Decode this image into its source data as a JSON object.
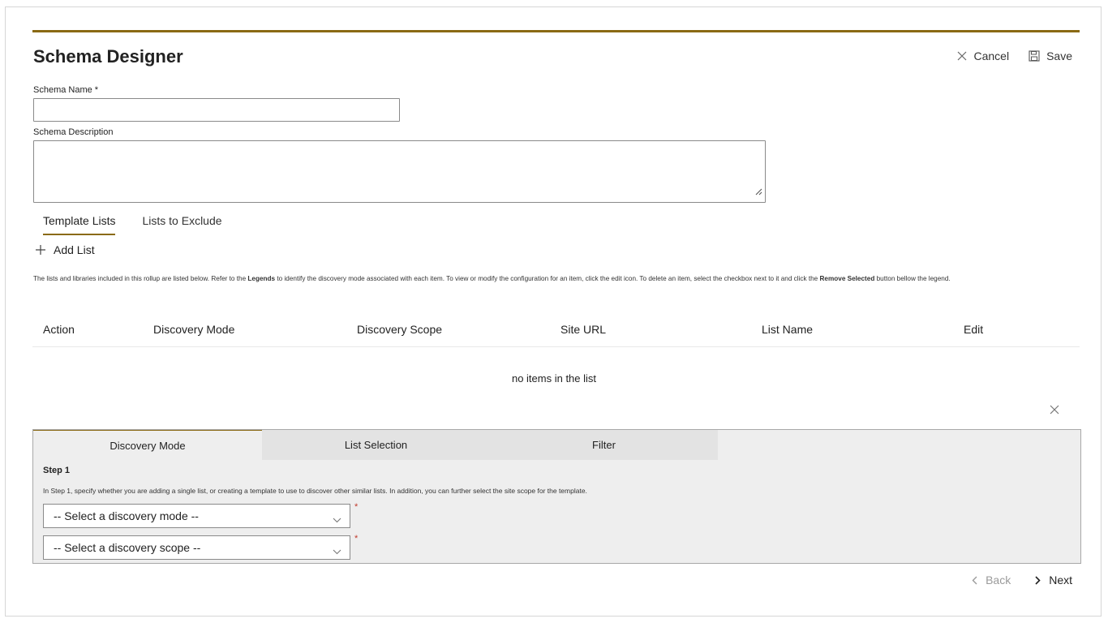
{
  "header": {
    "title": "Schema Designer",
    "cancel_label": "Cancel",
    "save_label": "Save",
    "accent_color": "#8a6a14"
  },
  "form": {
    "schema_name_label": "Schema Name *",
    "schema_name_value": "",
    "schema_description_label": "Schema Description",
    "schema_description_value": ""
  },
  "tabs": [
    {
      "label": "Template Lists",
      "active": true
    },
    {
      "label": "Lists to Exclude",
      "active": false
    }
  ],
  "add_list_label": "Add List",
  "help_text": {
    "part1": "The lists and libraries included in this rollup are listed below. Refer to the ",
    "legends": "Legends",
    "part2": " to identify the discovery mode associated with each item. To view or modify the configuration for an item, click the edit icon. To delete an item, select the checkbox next to it and click the ",
    "remove_selected": "Remove Selected",
    "part3": " button bellow the legend."
  },
  "table": {
    "columns": [
      "Action",
      "Discovery Mode",
      "Discovery Scope",
      "Site URL",
      "List Name",
      "Edit"
    ],
    "rows": [],
    "empty_text": "no items in the list"
  },
  "wizard": {
    "tabs": [
      {
        "label": "Discovery Mode",
        "active": true
      },
      {
        "label": "List Selection",
        "active": false
      },
      {
        "label": "Filter",
        "active": false
      }
    ],
    "step_title": "Step 1",
    "step_text": "In Step 1, specify whether you are adding a single list, or creating a template to use to discover other similar lists. In addition, you can further select the site scope for the template.",
    "discovery_mode_placeholder": "-- Select a discovery mode --",
    "discovery_scope_placeholder": "-- Select a discovery scope --",
    "required_mark": "*"
  },
  "nav": {
    "back_label": "Back",
    "next_label": "Next"
  }
}
